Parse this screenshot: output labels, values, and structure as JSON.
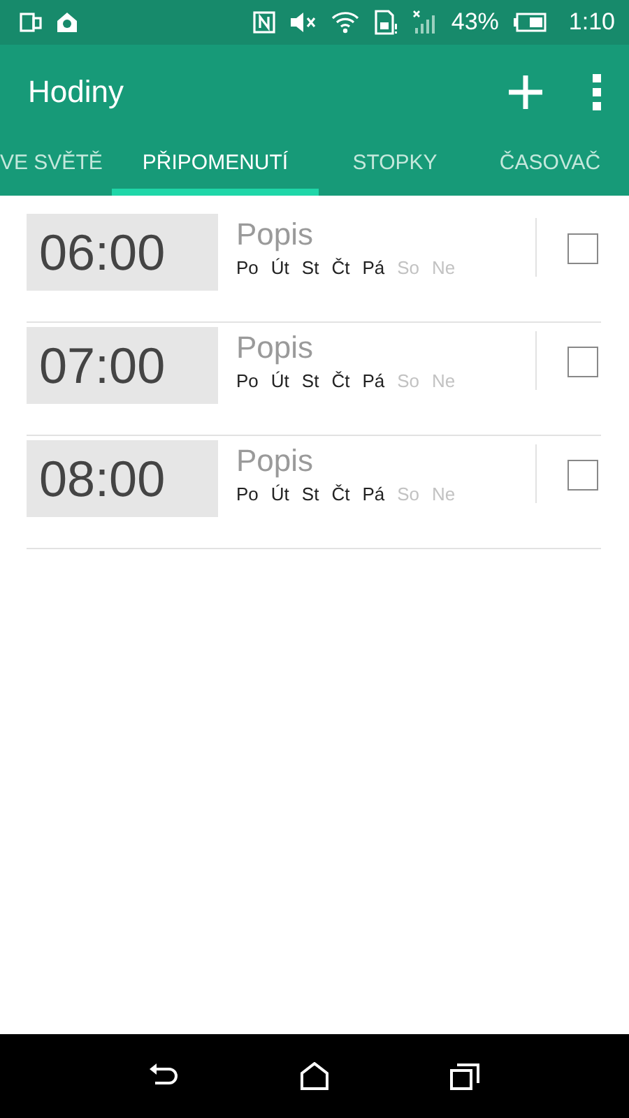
{
  "status_bar": {
    "battery": "43%",
    "time": "1:10"
  },
  "app_bar": {
    "title": "Hodiny"
  },
  "tabs": [
    {
      "label": "VE SVĚTĚ",
      "selected": false
    },
    {
      "label": "PŘIPOMENUTÍ",
      "selected": true
    },
    {
      "label": "STOPKY",
      "selected": false
    },
    {
      "label": "ČASOVAČ",
      "selected": false
    }
  ],
  "alarms": [
    {
      "time": "06:00",
      "description": "Popis",
      "checked": false,
      "days": [
        {
          "label": "Po",
          "on": true
        },
        {
          "label": "Út",
          "on": true
        },
        {
          "label": "St",
          "on": true
        },
        {
          "label": "Čt",
          "on": true
        },
        {
          "label": "Pá",
          "on": true
        },
        {
          "label": "So",
          "on": false
        },
        {
          "label": "Ne",
          "on": false
        }
      ]
    },
    {
      "time": "07:00",
      "description": "Popis",
      "checked": false,
      "days": [
        {
          "label": "Po",
          "on": true
        },
        {
          "label": "Út",
          "on": true
        },
        {
          "label": "St",
          "on": true
        },
        {
          "label": "Čt",
          "on": true
        },
        {
          "label": "Pá",
          "on": true
        },
        {
          "label": "So",
          "on": false
        },
        {
          "label": "Ne",
          "on": false
        }
      ]
    },
    {
      "time": "08:00",
      "description": "Popis",
      "checked": false,
      "days": [
        {
          "label": "Po",
          "on": true
        },
        {
          "label": "Út",
          "on": true
        },
        {
          "label": "St",
          "on": true
        },
        {
          "label": "Čt",
          "on": true
        },
        {
          "label": "Pá",
          "on": true
        },
        {
          "label": "So",
          "on": false
        },
        {
          "label": "Ne",
          "on": false
        }
      ]
    }
  ]
}
